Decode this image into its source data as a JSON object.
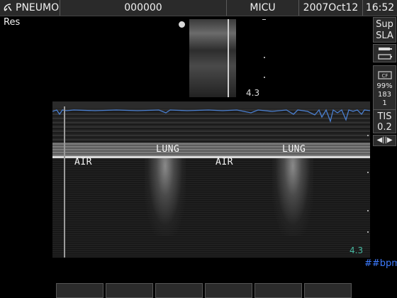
{
  "topbar": {
    "preset": "PNEUMO",
    "patient_id": "000000",
    "department": "MICU",
    "date": "2007Oct12",
    "time": "16:52"
  },
  "image": {
    "res_label": "Res",
    "depth_top": "4.3",
    "depth_bottom": "4.3",
    "heart_rate": "##bpm",
    "labels": {
      "air_left": "AIR",
      "lung_left": "LUNG",
      "air_right": "AIR",
      "lung_right": "LUNG"
    }
  },
  "sidebar": {
    "preset_top": "Sup",
    "preset_bottom": "SLA",
    "cf_label": "CF",
    "percent": "99%",
    "value1": "183",
    "value2": "1",
    "tis_label": "TIS",
    "tis_value": "0.2"
  },
  "icons": {
    "logo": "probe-logo-icon",
    "transducer": "transducer-icon",
    "battery": "battery-icon",
    "cf": "color-flow-icon",
    "sweep": "sweep-speed-icon"
  },
  "softkeys_count": 6
}
